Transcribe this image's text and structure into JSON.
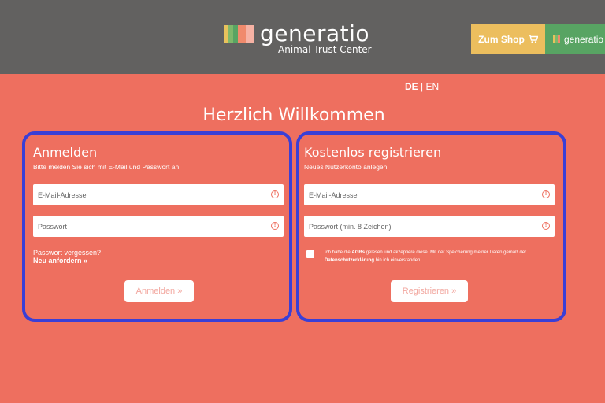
{
  "header": {
    "logo_name": "generatio",
    "logo_sub": "Animal Trust Center",
    "logo_colors": [
      "#e8c25c",
      "#7fb86b",
      "#58a463",
      "#f08a6c",
      "#ec6a5e"
    ],
    "shop_label": "Zum Shop",
    "shop_icon": "shopping-cart-icon",
    "gen_label": "generatio"
  },
  "lang": {
    "de": "DE",
    "sep": "|",
    "en": "EN"
  },
  "welcome": "Herzlich Willkommen",
  "login": {
    "title": "Anmelden",
    "subtitle": "Bitte melden Sie sich mit E-Mail und Passwort an",
    "email_placeholder": "E-Mail-Adresse",
    "password_placeholder": "Passwort",
    "forgot": "Passwort vergessen?",
    "forgot_link": "Neu anfordern »",
    "button": "Anmelden »"
  },
  "register": {
    "title": "Kostenlos registrieren",
    "subtitle": "Neues Nutzerkonto anlegen",
    "email_placeholder": "E-Mail-Adresse",
    "password_placeholder": "Passwort (min. 8 Zeichen)",
    "terms_1": "Ich habe die ",
    "terms_agb": "AGBs",
    "terms_2": " gelesen und akzeptiere diese. Mit der Speicherung meiner Daten gemäß der ",
    "terms_privacy": "Datenschutzerklärung",
    "terms_3": " bin ich einverstanden",
    "button": "Registrieren »"
  },
  "colors": {
    "background": "#ee6f5f",
    "header": "#626160",
    "shop": "#ecbe5e",
    "gen": "#58a463",
    "highlight": "#3a3fd6"
  }
}
